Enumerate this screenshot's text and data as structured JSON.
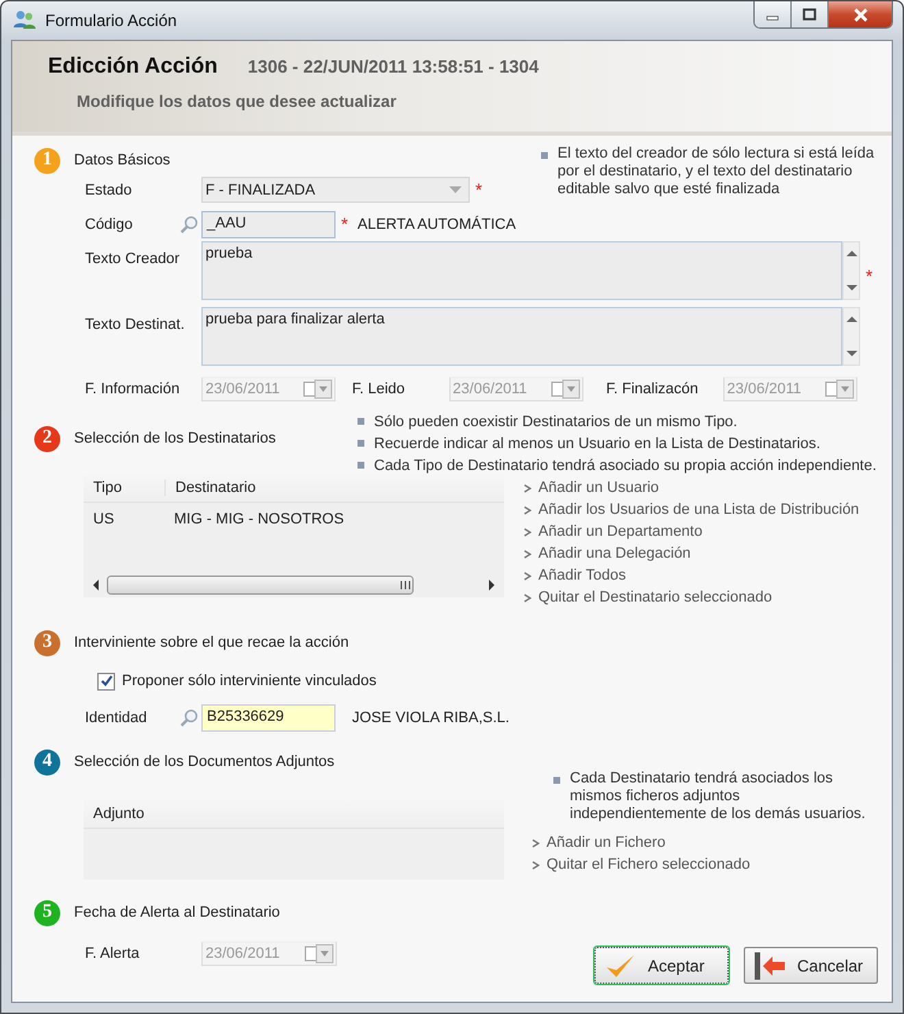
{
  "window": {
    "title": "Formulario Acción"
  },
  "header": {
    "title": "Edicción Acción",
    "info": "1306 - 22/JUN/2011 13:58:51 - 1304",
    "subtitle": "Modifique los datos que desee actualizar"
  },
  "sections": [
    {
      "number": "1",
      "title": "Datos Básicos",
      "color": "#f4a21c"
    },
    {
      "number": "2",
      "title": "Selección de los Destinatarios",
      "color": "#e5391a"
    },
    {
      "number": "3",
      "title": "Interviniente sobre el que recae la acción",
      "color": "#c9702e"
    },
    {
      "number": "4",
      "title": "Selección de los Documentos Adjuntos",
      "color": "#10739a"
    },
    {
      "number": "5",
      "title": "Fecha de Alerta al Destinatario",
      "color": "#1fb41f"
    }
  ],
  "datos_basicos": {
    "required_mark": "*",
    "note": "El texto del creador de sólo lectura si está leída por el destinatario, y el texto del destinatario editable salvo que esté finalizada",
    "estado": {
      "label": "Estado",
      "value": "F - FINALIZADA",
      "required": true
    },
    "codigo": {
      "label": "Código",
      "value": "_AAU",
      "required": true,
      "description": "ALERTA AUTOMÁTICA"
    },
    "texto_creador": {
      "label": "Texto Creador",
      "value": "prueba",
      "required": true
    },
    "texto_destinat": {
      "label": "Texto Destinat.",
      "value": "prueba para finalizar alerta"
    },
    "dates": [
      {
        "label": "F. Información",
        "value": "23/06/2011",
        "disabled": true
      },
      {
        "label": "F. Leido",
        "value": "23/06/2011",
        "disabled": true
      },
      {
        "label": "F. Finalizacón",
        "value": "23/06/2011",
        "disabled": true
      }
    ]
  },
  "destinatarios": {
    "notes": [
      "Sólo pueden coexistir Destinatarios de un mismo Tipo.",
      "Recuerde indicar al menos un Usuario en la Lista de Destinatarios.",
      "Cada Tipo de Destinatario tendrá asociado su propia acción independiente."
    ],
    "table": {
      "columns": [
        "Tipo",
        "Destinatario"
      ],
      "rows": [
        [
          "US",
          "MIG - MIG - NOSOTROS"
        ]
      ]
    },
    "actions": [
      "Añadir un Usuario",
      "Añadir los Usuarios de una Lista de Distribución",
      "Añadir un Departamento",
      "Añadir una Delegación",
      "Añadir Todos",
      "Quitar el Destinatario seleccionado"
    ]
  },
  "interviniente": {
    "checkbox": {
      "label": "Proponer sólo interviniente vinculados",
      "checked": true
    },
    "identidad": {
      "label": "Identidad",
      "value": "B25336629",
      "name": "JOSE VIOLA RIBA,S.L."
    }
  },
  "documentos": {
    "note": "Cada Destinatario tendrá asociados los mismos ficheros adjuntos independientemente de los demás usuarios.",
    "table": {
      "columns": [
        "Adjunto"
      ]
    },
    "actions": [
      "Añadir un Fichero",
      "Quitar el Fichero seleccionado"
    ]
  },
  "alerta": {
    "label": "F. Alerta",
    "value": "23/06/2011",
    "disabled": true
  },
  "buttons": [
    {
      "label": "Aceptar",
      "kind": "accept",
      "focused": true
    },
    {
      "label": "Cancelar",
      "kind": "cancel",
      "focused": false
    }
  ]
}
